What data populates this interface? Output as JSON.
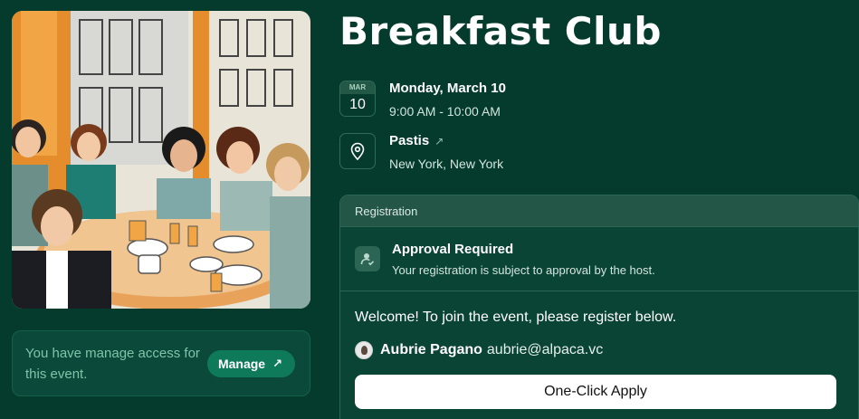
{
  "event": {
    "title": "Breakfast Club",
    "date": {
      "month": "MAR",
      "day": "10",
      "full": "Monday, March 10",
      "time": "9:00 AM - 10:00 AM"
    },
    "location": {
      "name": "Pastis",
      "city": "New York, New York",
      "link_icon": "arrow-up-right-icon"
    }
  },
  "manage": {
    "text": "You have manage access for this event.",
    "button_label": "Manage",
    "button_icon": "arrow-up-right-icon"
  },
  "registration": {
    "header": "Registration",
    "approval_title": "Approval Required",
    "approval_text": "Your registration is subject to approval by the host.",
    "welcome": "Welcome! To join the event, please register below.",
    "user_name": "Aubrie Pagano",
    "user_email": "aubrie@alpaca.vc",
    "apply_label": "One-Click Apply"
  },
  "colors": {
    "background": "#053b2d",
    "accent": "#0f7a5a",
    "card": "#0a4435"
  }
}
